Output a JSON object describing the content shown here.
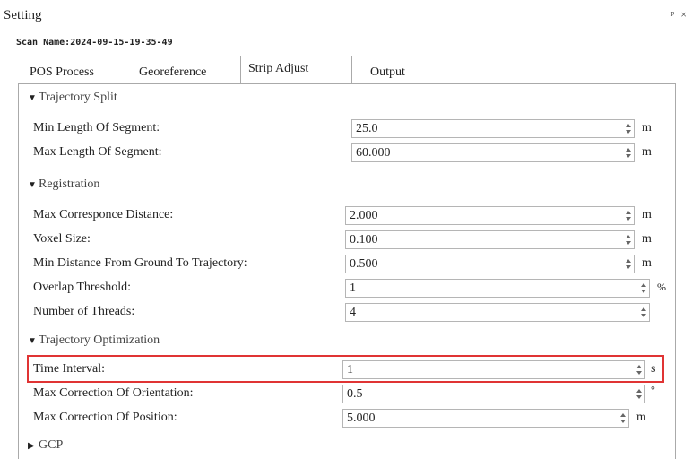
{
  "window": {
    "title": "Setting",
    "pin_glyph": "ᵖ ×"
  },
  "scan_name": "Scan Name:2024-09-15-19-35-49",
  "tabs": [
    {
      "label": "POS Process",
      "active": false
    },
    {
      "label": "Georeference",
      "active": false
    },
    {
      "label": "Strip Adjust",
      "active": true
    },
    {
      "label": "Output",
      "active": false
    }
  ],
  "sections": {
    "trajectory_split": "Trajectory Split",
    "registration": "Registration",
    "trajectory_optimization": "Trajectory Optimization",
    "gcp": "GCP"
  },
  "fields": {
    "min_length": {
      "label": "Min Length Of Segment:",
      "value": "25.0",
      "unit": "m"
    },
    "max_length": {
      "label": "Max Length Of Segment:",
      "value": "60.000",
      "unit": "m"
    },
    "max_corr_dist": {
      "label": "Max Corresponce Distance:",
      "value": "2.000",
      "unit": "m"
    },
    "voxel_size": {
      "label": "Voxel Size:",
      "value": "0.100",
      "unit": "m"
    },
    "min_dist_ground": {
      "label": "Min Distance From Ground To Trajectory:",
      "value": "0.500",
      "unit": "m"
    },
    "overlap": {
      "label": "Overlap Threshold:",
      "value": "1",
      "unit": "%"
    },
    "threads": {
      "label": "Number of Threads:",
      "value": "4",
      "unit": ""
    },
    "time_interval": {
      "label": "Time Interval:",
      "value": "1",
      "unit": "s"
    },
    "max_corr_orient": {
      "label": "Max Correction Of Orientation:",
      "value": "0.5",
      "unit": "°"
    },
    "max_corr_pos": {
      "label": "Max Correction Of Position:",
      "value": "5.000",
      "unit": "m"
    }
  },
  "highlight_color": "#e03434"
}
